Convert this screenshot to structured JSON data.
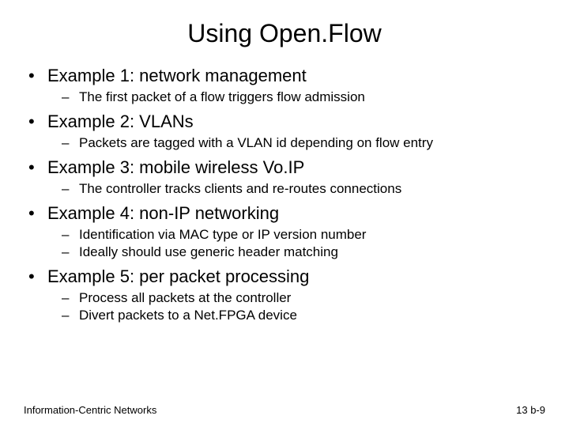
{
  "title": "Using Open.Flow",
  "items": [
    {
      "label": "Example 1: network management",
      "subs": [
        "The first packet of a flow triggers flow admission"
      ]
    },
    {
      "label": "Example 2: VLANs",
      "subs": [
        "Packets are tagged with a VLAN id depending on flow entry"
      ]
    },
    {
      "label": "Example 3: mobile wireless Vo.IP",
      "subs": [
        "The controller tracks clients and re-routes connections"
      ]
    },
    {
      "label": "Example 4: non-IP networking",
      "subs": [
        "Identification via MAC type or IP version number",
        "Ideally should use generic header matching"
      ]
    },
    {
      "label": "Example 5: per packet processing",
      "subs": [
        "Process all packets at the controller",
        "Divert packets to a Net.FPGA device"
      ]
    }
  ],
  "footer": {
    "left": "Information-Centric Networks",
    "right": "13 b-9"
  }
}
